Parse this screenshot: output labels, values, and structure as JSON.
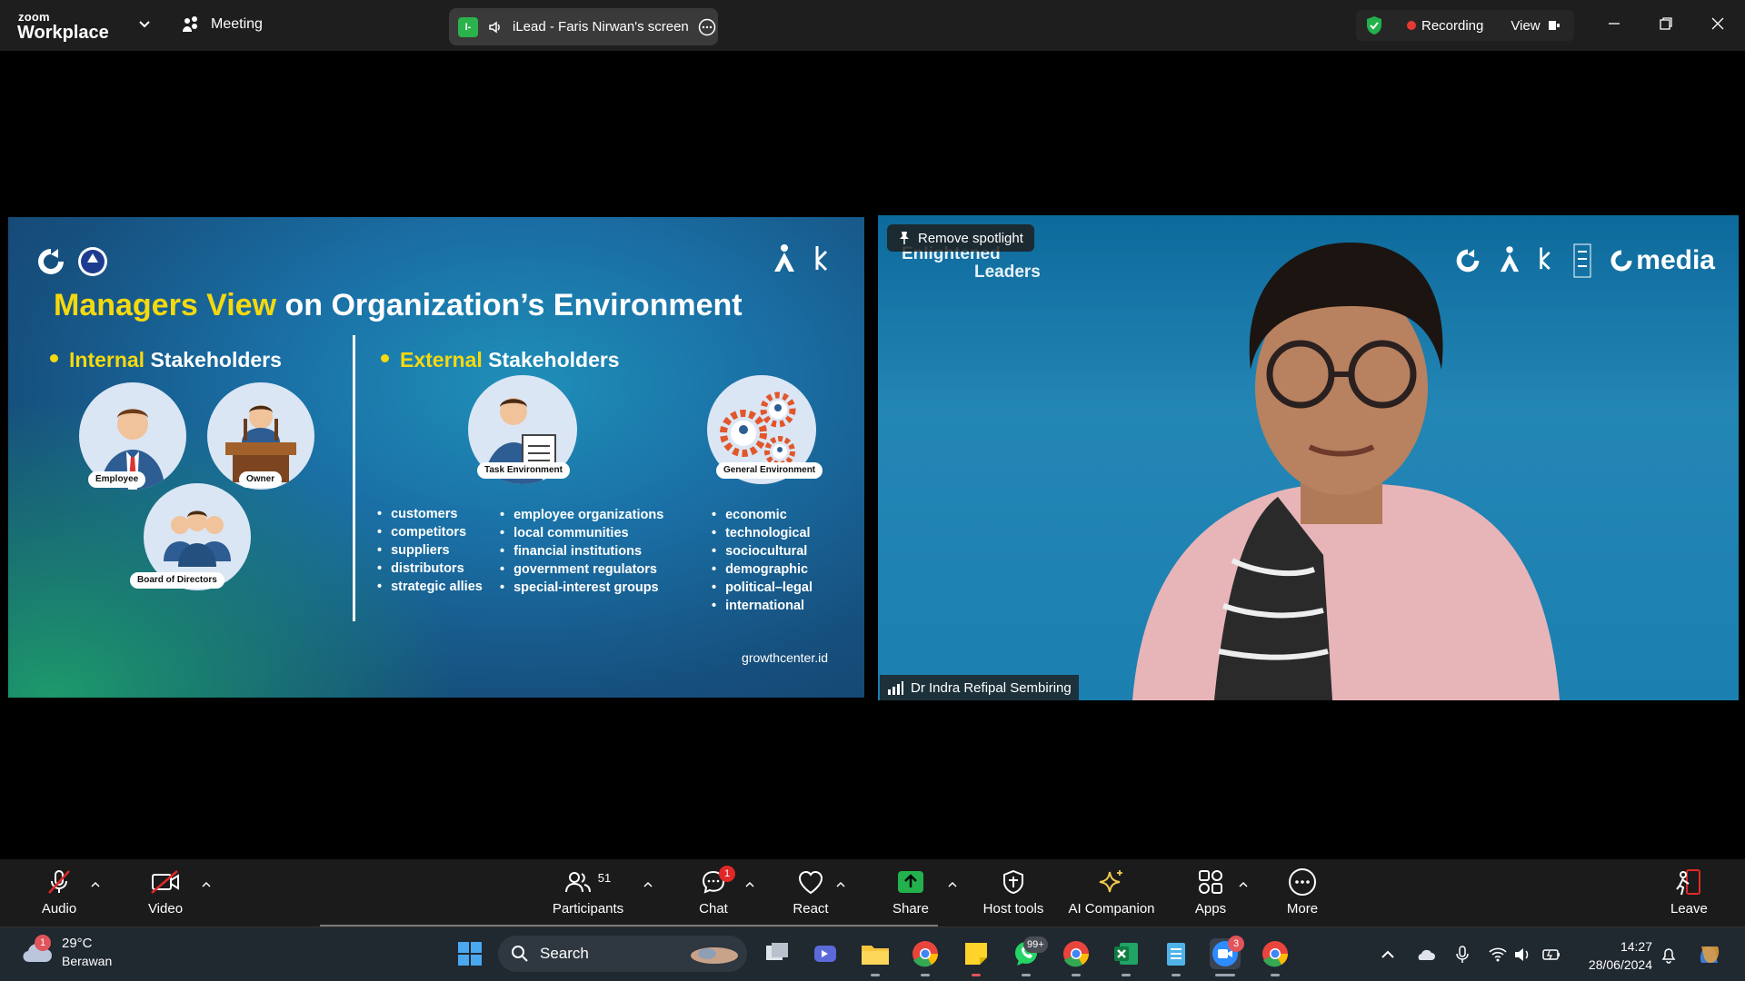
{
  "titlebar": {
    "logo_small": "zoom",
    "logo_big": "Workplace",
    "meeting_label": "Meeting",
    "share_label": "iLead - Faris Nirwan's screen",
    "recording_label": "Recording",
    "view_label": "View"
  },
  "slide": {
    "title_highlight": "Managers View",
    "title_rest": " on Organization’s Environment",
    "internal_highlight": "Internal",
    "internal_rest": " Stakeholders",
    "external_highlight": "External",
    "external_rest": " Stakeholders",
    "employee": "Employee",
    "owner": "Owner",
    "board": "Board of Directors",
    "task_env": "Task Environment",
    "general_env": "General Environment",
    "task_list_1": [
      "customers",
      "competitors",
      "suppliers",
      "distributors",
      "strategic allies"
    ],
    "task_list_2": [
      "employee organizations",
      "local communities",
      "financial institutions",
      "government regulators",
      "special-interest groups"
    ],
    "general_list": [
      "economic",
      "technological",
      "sociocultural",
      "demographic",
      "political–legal",
      "international"
    ],
    "site": "growthcenter.id",
    "logo_text_1": "Growth Center",
    "logo_text_2": "Kognisi"
  },
  "video": {
    "spotlight_button": "Remove spotlight",
    "bg_text_1": "Enlightened",
    "bg_text_2": "Leaders",
    "bg_logo_media": "media",
    "participant_name": "Dr Indra Refipal Sembiring"
  },
  "toolbar": {
    "audio": "Audio",
    "video": "Video",
    "participants": "Participants",
    "participants_count": "51",
    "chat": "Chat",
    "chat_badge": "1",
    "react": "React",
    "share": "Share",
    "host_tools": "Host tools",
    "ai_companion": "AI Companion",
    "apps": "Apps",
    "more": "More",
    "leave": "Leave"
  },
  "taskbar": {
    "temperature": "29°C",
    "weather": "Berawan",
    "weather_badge": "1",
    "search": "Search",
    "whatsapp_badge": "99+",
    "zoom_badge": "3",
    "time": "14:27",
    "date": "28/06/2024"
  },
  "colors": {
    "accent_yellow": "#f5d90f",
    "recording_red": "#e53935",
    "share_green": "#22b14c"
  }
}
